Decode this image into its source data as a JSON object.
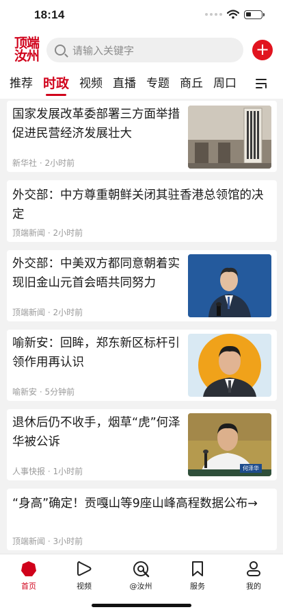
{
  "status": {
    "time": "18:14"
  },
  "header": {
    "logo_line1": "顶端",
    "logo_line2": "汝州",
    "search_placeholder": "请输入关键字",
    "add_label": "+"
  },
  "tabs": [
    {
      "label": "推荐",
      "active": false
    },
    {
      "label": "时政",
      "active": true
    },
    {
      "label": "视频",
      "active": false
    },
    {
      "label": "直播",
      "active": false
    },
    {
      "label": "专题",
      "active": false
    },
    {
      "label": "商丘",
      "active": false
    },
    {
      "label": "周口",
      "active": false
    }
  ],
  "feed": [
    {
      "title": "国家发展改革委部署三方面举措促进民营经济发展壮大",
      "source": "新华社",
      "time": "2小时前",
      "has_image": true,
      "image_icon": "government-building-photo"
    },
    {
      "title": "外交部：中方尊重朝鲜关闭其驻香港总领馆的决定",
      "source": "顶端新闻",
      "time": "2小时前",
      "has_image": false
    },
    {
      "title": "外交部：中美双方都同意朝着实现旧金山元首会晤共同努力",
      "source": "顶端新闻",
      "time": "2小时前",
      "has_image": true,
      "image_icon": "press-conference-photo"
    },
    {
      "title": "喻新安：回眸，郑东新区标杆引领作用再认识",
      "source": "喻新安",
      "time": "5分钟前",
      "has_image": true,
      "image_icon": "portrait-photo"
    },
    {
      "title": "退休后仍不收手，烟草“虎”何泽华被公诉",
      "source": "人事快报",
      "time": "1小时前",
      "has_image": true,
      "image_icon": "speech-photo",
      "image_caption": "何泽华"
    },
    {
      "title": "“身高”确定！贡嘎山等9座山峰高程数据公布→",
      "source": "顶端新闻",
      "time": "3小时前",
      "has_image": false
    }
  ],
  "bottom_nav": [
    {
      "label": "首页",
      "icon": "home-icon",
      "active": true
    },
    {
      "label": "视频",
      "icon": "play-icon",
      "active": false
    },
    {
      "label": "@汝州",
      "icon": "at-local-icon",
      "active": false
    },
    {
      "label": "服务",
      "icon": "bookmark-icon",
      "active": false
    },
    {
      "label": "我的",
      "icon": "profile-icon",
      "active": false
    }
  ],
  "colors": {
    "brand_red": "#d0021b",
    "accent_red": "#e1141f",
    "background": "#f2f2f2"
  }
}
